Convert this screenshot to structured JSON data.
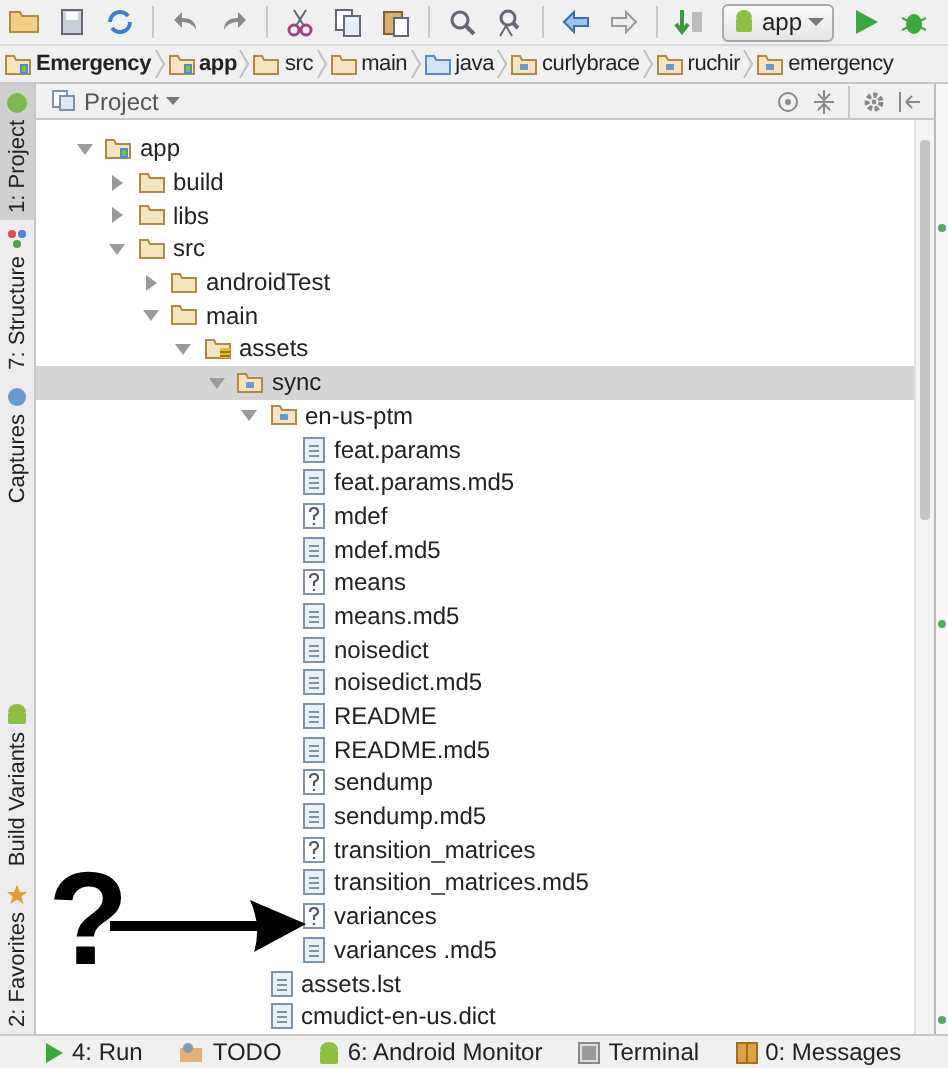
{
  "toolbar": {
    "run_config": "app"
  },
  "breadcrumbs": [
    {
      "label": "Emergency",
      "kind": "module"
    },
    {
      "label": "app",
      "kind": "module"
    },
    {
      "label": "src",
      "kind": "folder"
    },
    {
      "label": "main",
      "kind": "folder"
    },
    {
      "label": "java",
      "kind": "source"
    },
    {
      "label": "curlybrace",
      "kind": "package"
    },
    {
      "label": "ruchir",
      "kind": "package"
    },
    {
      "label": "emergency",
      "kind": "package"
    }
  ],
  "side_tabs": [
    {
      "label": "1: Project",
      "kind": "project",
      "selected": true
    },
    {
      "label": "7: Structure",
      "kind": "structure",
      "selected": false
    },
    {
      "label": "Captures",
      "kind": "captures",
      "selected": false
    },
    {
      "label": "Build Variants",
      "kind": "variants",
      "selected": false
    },
    {
      "label": "2: Favorites",
      "kind": "favorites",
      "selected": false
    }
  ],
  "project_panel": {
    "title": "Project",
    "tree": [
      {
        "label": "app",
        "kind": "module",
        "expanded": true,
        "selected": false,
        "children": [
          {
            "label": "build",
            "kind": "folder",
            "expanded": false,
            "selected": false
          },
          {
            "label": "libs",
            "kind": "folder",
            "expanded": false,
            "selected": false
          },
          {
            "label": "src",
            "kind": "folder",
            "expanded": true,
            "selected": false,
            "children": [
              {
                "label": "androidTest",
                "kind": "folder",
                "expanded": false,
                "selected": false
              },
              {
                "label": "main",
                "kind": "folder",
                "expanded": true,
                "selected": false,
                "children": [
                  {
                    "label": "assets",
                    "kind": "assets",
                    "expanded": true,
                    "selected": false,
                    "children": [
                      {
                        "label": "sync",
                        "kind": "package",
                        "expanded": true,
                        "selected": true,
                        "children": [
                          {
                            "label": "en-us-ptm",
                            "kind": "package",
                            "expanded": true,
                            "selected": false,
                            "children": [
                              {
                                "label": "feat.params",
                                "kind": "file",
                                "selected": false
                              },
                              {
                                "label": "feat.params.md5",
                                "kind": "file",
                                "selected": false
                              },
                              {
                                "label": "mdef",
                                "kind": "unknown",
                                "selected": false
                              },
                              {
                                "label": "mdef.md5",
                                "kind": "file",
                                "selected": false
                              },
                              {
                                "label": "means",
                                "kind": "unknown",
                                "selected": false
                              },
                              {
                                "label": "means.md5",
                                "kind": "file",
                                "selected": false
                              },
                              {
                                "label": "noisedict",
                                "kind": "file",
                                "selected": false
                              },
                              {
                                "label": "noisedict.md5",
                                "kind": "file",
                                "selected": false
                              },
                              {
                                "label": "README",
                                "kind": "file",
                                "selected": false
                              },
                              {
                                "label": "README.md5",
                                "kind": "file",
                                "selected": false
                              },
                              {
                                "label": "sendump",
                                "kind": "unknown",
                                "selected": false
                              },
                              {
                                "label": "sendump.md5",
                                "kind": "file",
                                "selected": false
                              },
                              {
                                "label": "transition_matrices",
                                "kind": "unknown",
                                "selected": false
                              },
                              {
                                "label": "transition_matrices.md5",
                                "kind": "file",
                                "selected": false
                              },
                              {
                                "label": "variances",
                                "kind": "unknown",
                                "selected": false
                              },
                              {
                                "label": "variances .md5",
                                "kind": "file",
                                "selected": false
                              }
                            ]
                          },
                          {
                            "label": "assets.lst",
                            "kind": "file",
                            "selected": false
                          },
                          {
                            "label": "cmudict-en-us.dict",
                            "kind": "file",
                            "selected": false
                          }
                        ]
                      }
                    ]
                  }
                ]
              }
            ]
          }
        ]
      }
    ]
  },
  "annotation": {
    "mark": "?"
  },
  "bottom_tabs": [
    {
      "label": "4: Run",
      "kind": "run"
    },
    {
      "label": "TODO",
      "kind": "todo"
    },
    {
      "label": "6: Android Monitor",
      "kind": "android"
    },
    {
      "label": "Terminal",
      "kind": "terminal"
    },
    {
      "label": "0: Messages",
      "kind": "messages"
    }
  ]
}
